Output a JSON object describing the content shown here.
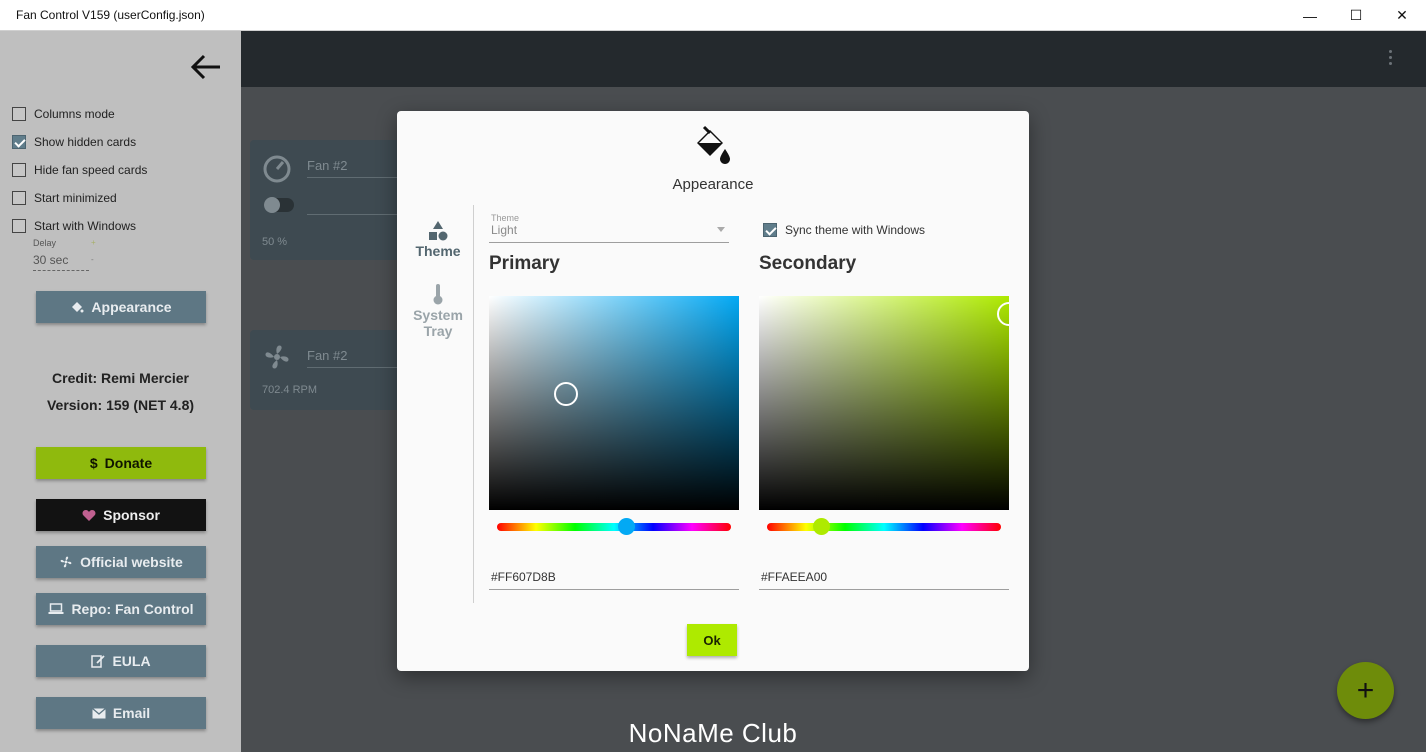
{
  "window": {
    "title": "Fan Control V159 (userConfig.json)",
    "minimize_glyph": "—",
    "maximize_glyph": "☐",
    "close_glyph": "✕"
  },
  "sidebar": {
    "options": [
      {
        "label": "Columns mode",
        "checked": false
      },
      {
        "label": "Show hidden cards",
        "checked": true
      },
      {
        "label": "Hide fan speed cards",
        "checked": false
      },
      {
        "label": "Start minimized",
        "checked": false
      },
      {
        "label": "Start with Windows",
        "checked": false
      }
    ],
    "delay": {
      "label": "Delay",
      "value": "30 sec",
      "up_glyph": "+",
      "down_glyph": "-"
    },
    "appearance_label": "Appearance",
    "credit": "Credit: Remi Mercier",
    "version": "Version: 159 (NET 4.8)",
    "buttons": {
      "donate": "Donate",
      "sponsor": "Sponsor",
      "website": "Official website",
      "repo": "Repo: Fan Control",
      "eula": "EULA",
      "email": "Email"
    },
    "donate_glyph": "$"
  },
  "cards": [
    {
      "name": "Fan #2",
      "sub": "50 %"
    },
    {
      "name": "Fan #2",
      "sub": "702.4 RPM"
    }
  ],
  "dialog": {
    "title": "Appearance",
    "tabs": {
      "theme": "Theme",
      "system_tray": "System Tray"
    },
    "theme_label": "Theme",
    "theme_value": "Light",
    "sync_label": "Sync theme with Windows",
    "sync_checked": true,
    "primary": {
      "title": "Primary",
      "hex": "#FF607D8B",
      "color": "#03a9f4"
    },
    "secondary": {
      "title": "Secondary",
      "hex": "#FFAEEA00",
      "color": "#aeea00"
    },
    "ok_label": "Ok"
  },
  "fab_glyph": "+",
  "watermark": "NoNaMe Club"
}
